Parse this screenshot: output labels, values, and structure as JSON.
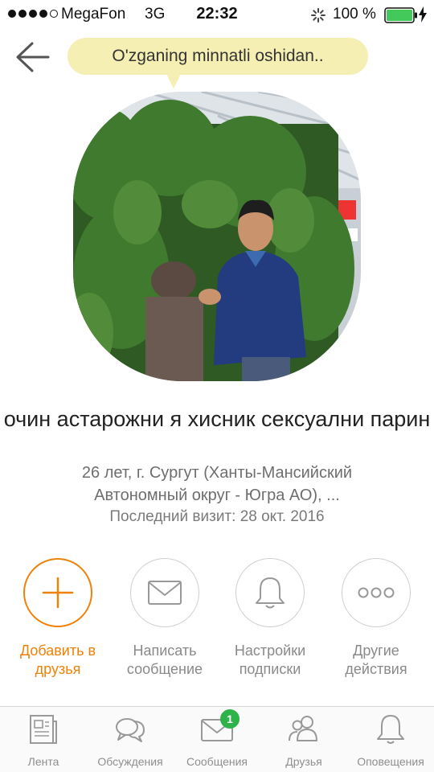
{
  "status_bar": {
    "carrier": "MegaFon",
    "network": "3G",
    "time": "22:32",
    "battery": "100 %",
    "signal_bars_filled": 4,
    "signal_bars_total": 5,
    "battery_color": "#43c95a"
  },
  "header": {
    "back_icon": "arrow-left-icon",
    "status_bubble": "O'zganing minnatli oshidan..",
    "bubble_color": "#f5efb3"
  },
  "profile": {
    "name": "очин астарожни я хисник сексуални парин",
    "info": "26 лет, г. Сургут (Ханты-Мансийский Автономный округ - Югра АО), ...",
    "last_visit": "Последний визит: 28 окт. 2016"
  },
  "actions": [
    {
      "label": "Добавить в друзья",
      "icon": "plus-icon"
    },
    {
      "label": "Написать сообщение",
      "icon": "envelope-icon"
    },
    {
      "label": "Настройки подписки",
      "icon": "bell-icon"
    },
    {
      "label": "Другие действия",
      "icon": "more-icon"
    }
  ],
  "accent_color": "#ee8208",
  "tabs": [
    {
      "label": "Лента",
      "icon": "newspaper-icon"
    },
    {
      "label": "Обсуждения",
      "icon": "chat-bubbles-icon"
    },
    {
      "label": "Сообщения",
      "icon": "envelope-icon",
      "badge": "1"
    },
    {
      "label": "Друзья",
      "icon": "friends-icon"
    },
    {
      "label": "Оповещения",
      "icon": "bell-icon"
    }
  ],
  "badge_color": "#2db34a"
}
